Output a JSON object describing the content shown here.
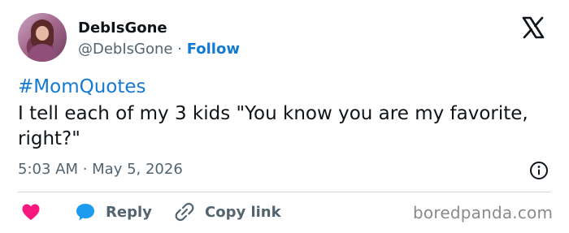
{
  "author": {
    "display_name": "DebIsGone",
    "handle": "@DebIsGone",
    "separator": "·",
    "follow_label": "Follow"
  },
  "tweet": {
    "hashtag": "#MomQuotes",
    "text": "I tell each of my 3 kids \"You know you are my favorite, right?\"",
    "timestamp": "5:03 AM · May 5, 2026"
  },
  "actions": {
    "reply_label": "Reply",
    "copy_link_label": "Copy link"
  },
  "icons": {
    "logo": "x-logo-icon",
    "info": "info-icon",
    "like": "heart-icon",
    "reply": "speech-bubble-icon",
    "copy": "link-icon"
  },
  "colors": {
    "accent_blue": "#1479d2",
    "heart_pink": "#f91880",
    "muted_gray": "#536471",
    "text_dark": "#0f1419"
  },
  "watermark": "boredpanda.com"
}
